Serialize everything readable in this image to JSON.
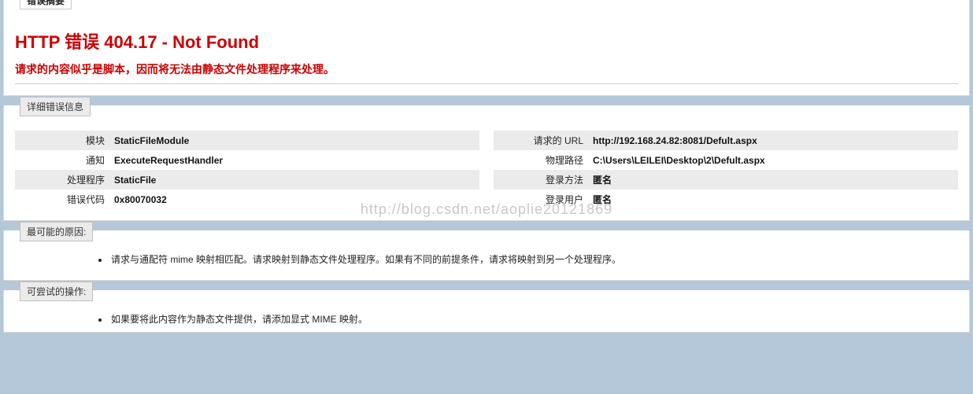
{
  "summary": {
    "legend": "错误摘要",
    "title": "HTTP 错误 404.17 - Not Found",
    "subtitle": "请求的内容似乎是脚本，因而将无法由静态文件处理程序来处理。"
  },
  "detail": {
    "legend": "详细错误信息",
    "left": [
      {
        "label": "模块",
        "value": "StaticFileModule"
      },
      {
        "label": "通知",
        "value": "ExecuteRequestHandler"
      },
      {
        "label": "处理程序",
        "value": "StaticFile"
      },
      {
        "label": "错误代码",
        "value": "0x80070032"
      }
    ],
    "right": [
      {
        "label": "请求的 URL",
        "value": "http://192.168.24.82:8081/Defult.aspx"
      },
      {
        "label": "物理路径",
        "value": "C:\\Users\\LEILEI\\Desktop\\2\\Defult.aspx"
      },
      {
        "label": "登录方法",
        "value": "匿名"
      },
      {
        "label": "登录用户",
        "value": "匿名"
      }
    ]
  },
  "causes": {
    "legend": "最可能的原因:",
    "items": [
      "请求与通配符 mime 映射相匹配。请求映射到静态文件处理程序。如果有不同的前提条件，请求将映射到另一个处理程序。"
    ]
  },
  "actions": {
    "legend": "可尝试的操作:",
    "items": [
      "如果要将此内容作为静态文件提供，请添加显式 MIME 映射。"
    ]
  },
  "watermark": "http://blog.csdn.net/aoplie20121869"
}
